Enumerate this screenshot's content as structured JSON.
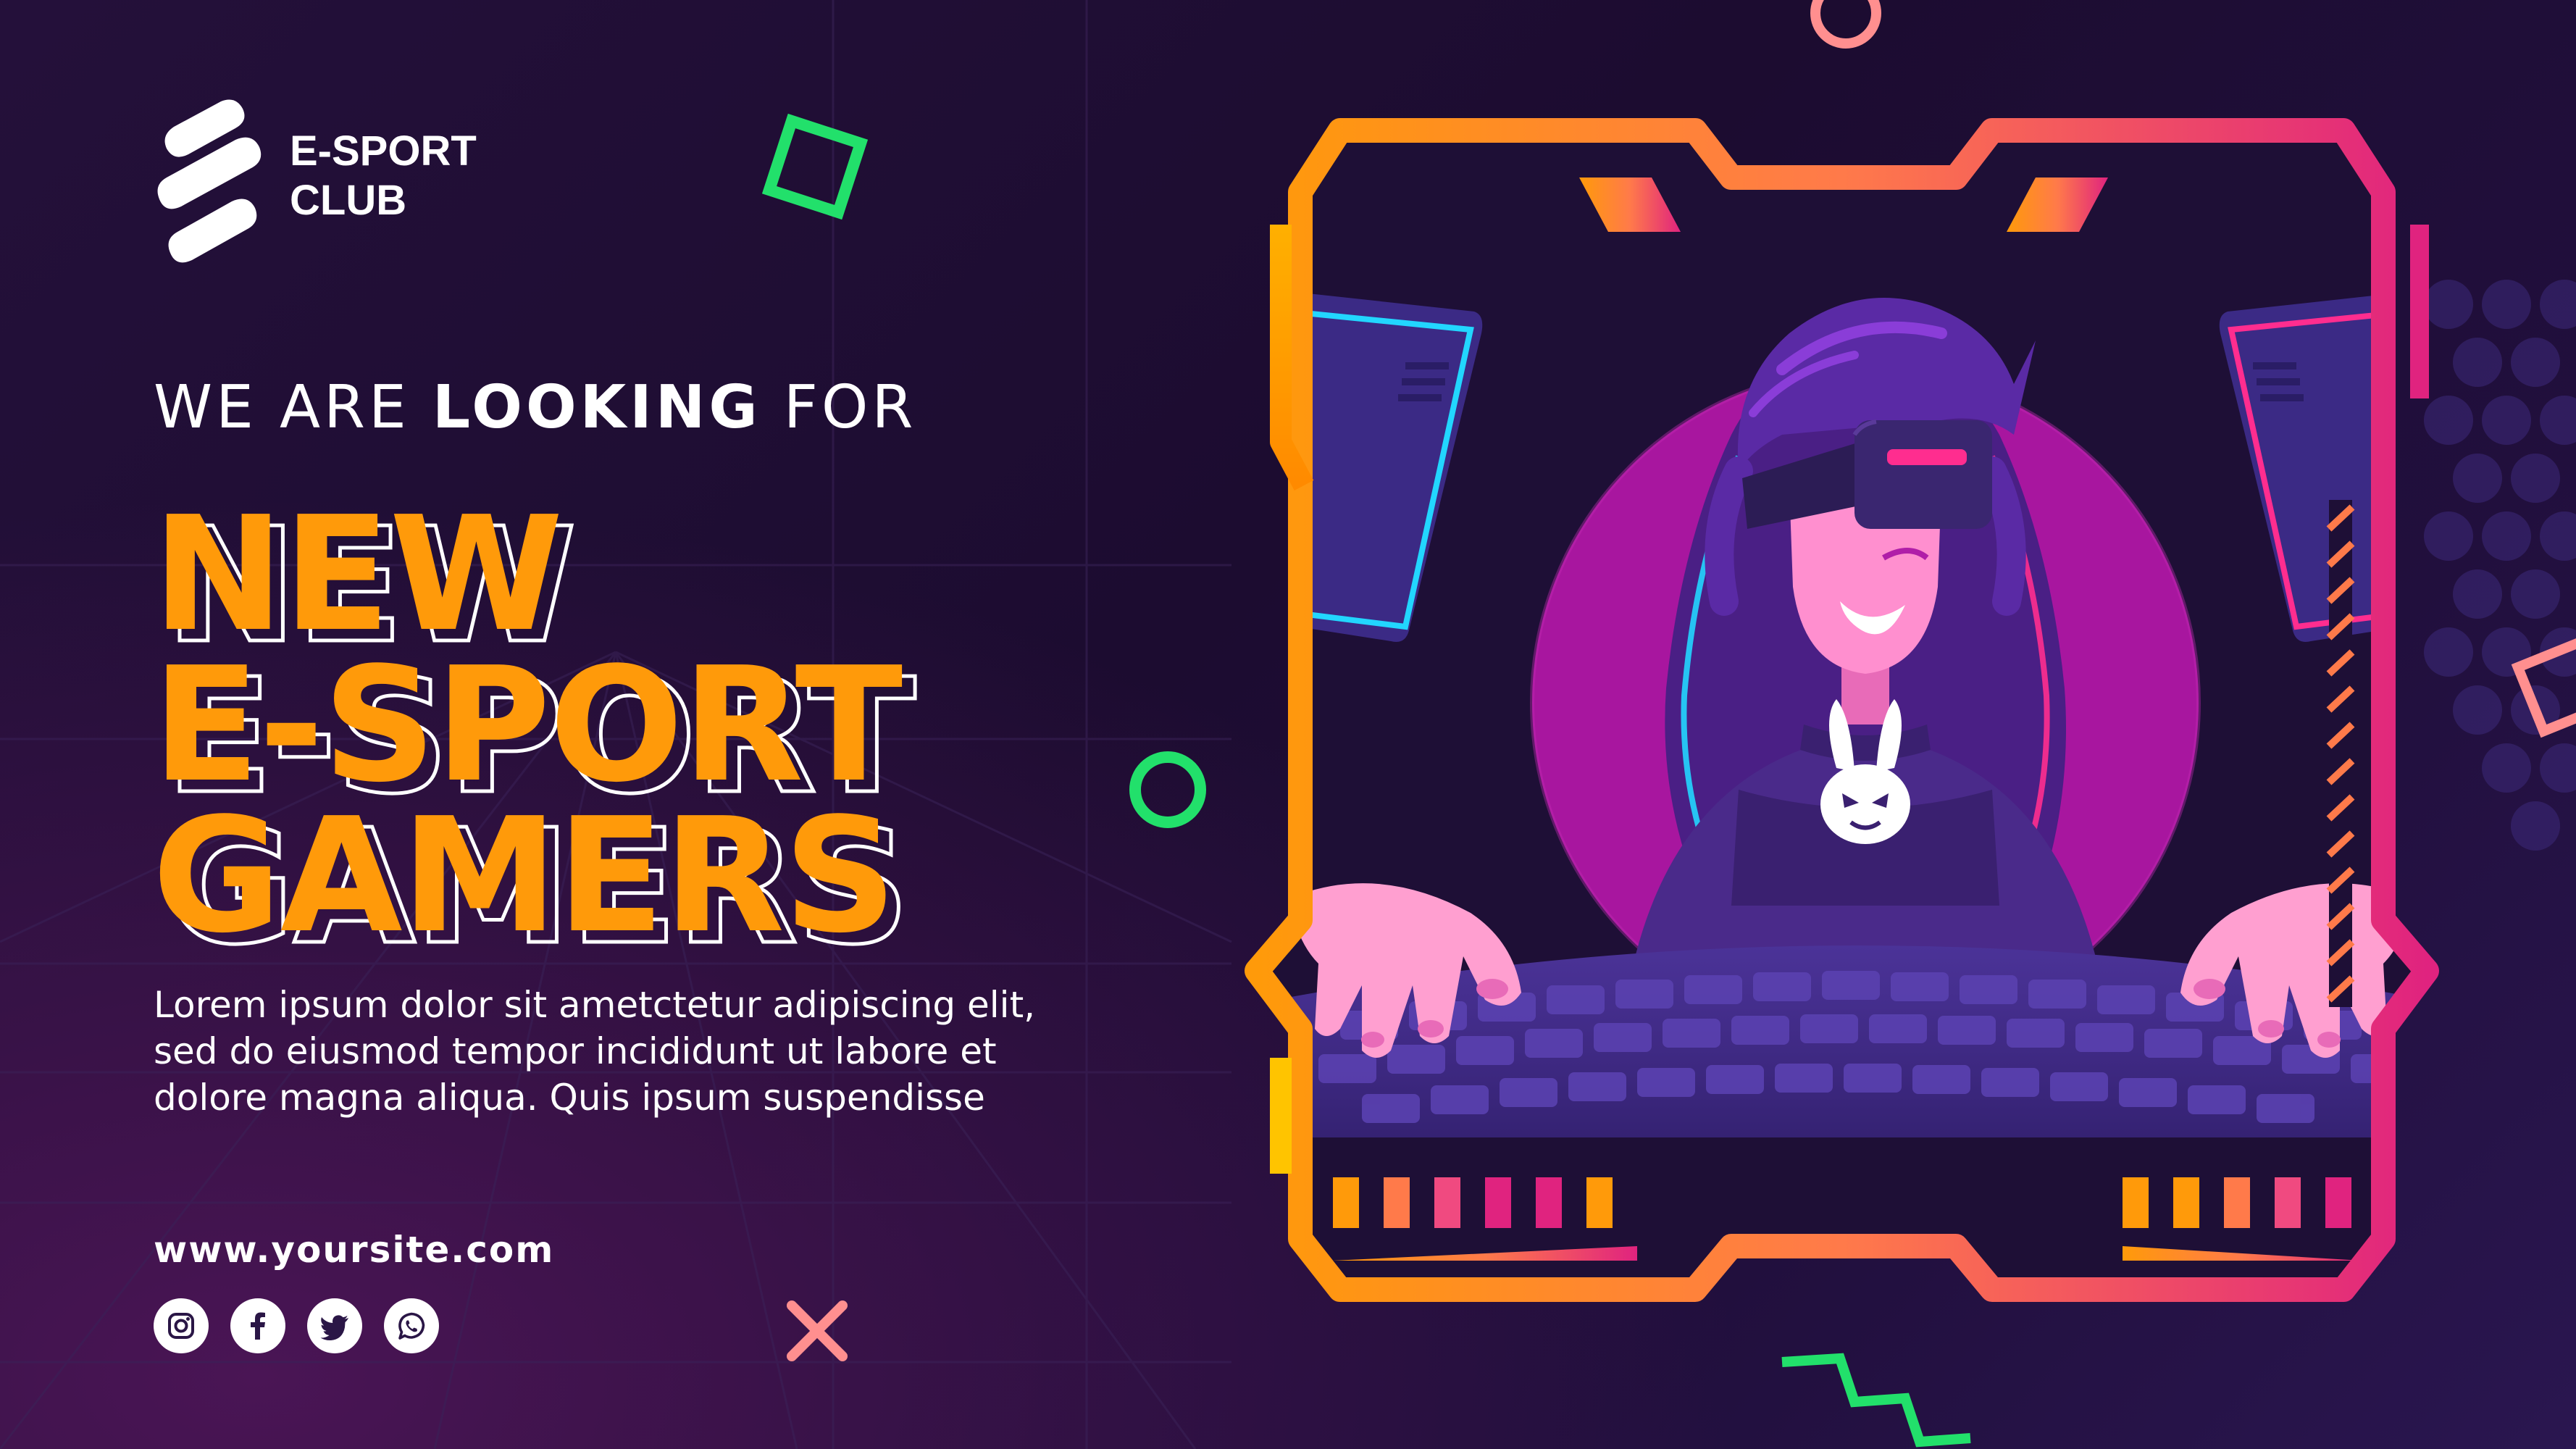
{
  "brand": {
    "name_line1": "E-SPORT",
    "name_line2": "CLUB"
  },
  "tagline": {
    "part1": "WE ARE ",
    "part2": "LOOKING",
    "part3": " FOR"
  },
  "headline": {
    "line1": "NEW",
    "line2": "E-SPORT",
    "line3": "GAMERS"
  },
  "description": {
    "line1": "Lorem ipsum dolor sit ametctetur adipiscing elit,",
    "line2": "sed do eiusmod tempor incididunt ut labore et",
    "line3": "dolore magna aliqua. Quis ipsum suspendisse"
  },
  "website": "www.yoursite.com",
  "social": [
    "instagram-icon",
    "facebook-icon",
    "twitter-icon",
    "whatsapp-icon"
  ],
  "colors": {
    "background": "#1c0c30",
    "headline": "#ff9a0a",
    "accent_green": "#22e06b",
    "accent_pink": "#ff8f8f",
    "frame_orange": "#ff9a0a",
    "frame_magenta": "#e0237f",
    "circle_purple": "#b01ea8"
  },
  "illustration": {
    "subject": "gamer-girl-vr-headset-keyboard",
    "shirt_logo": "bunny-icon"
  }
}
